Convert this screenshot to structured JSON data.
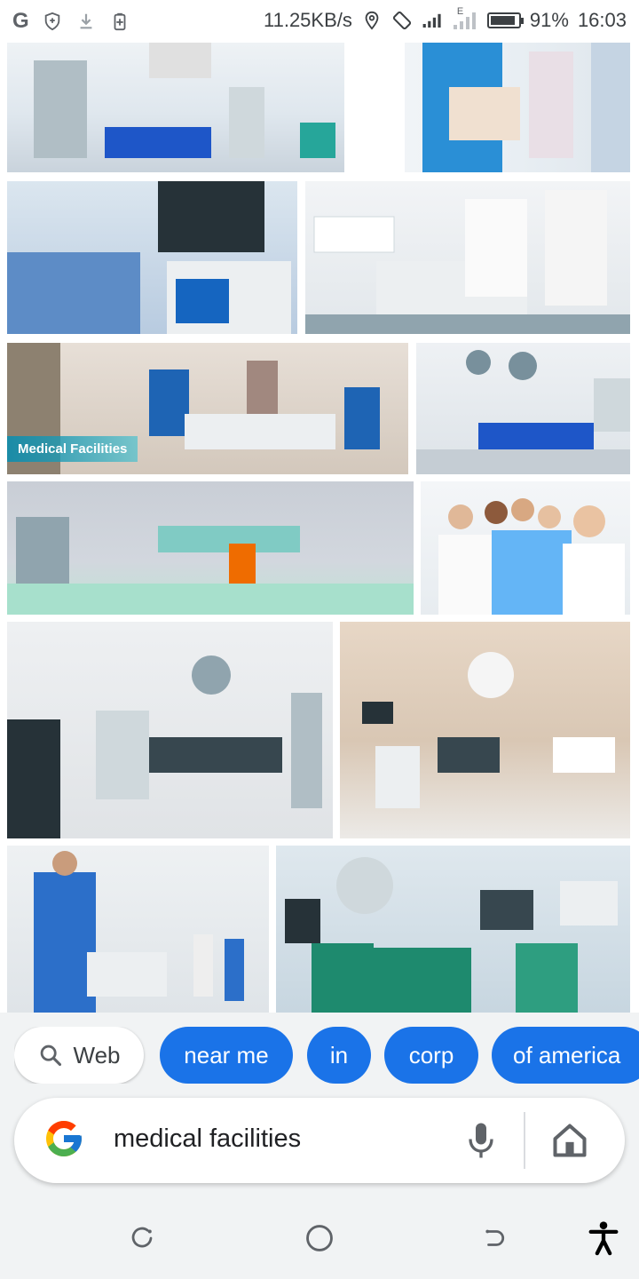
{
  "status_bar": {
    "app_letter": "G",
    "speed": "11.25KB/s",
    "network_type": "E",
    "battery": "91%",
    "battery_level": 0.91,
    "time": "16:03"
  },
  "results": {
    "caption_medical_facilities": "Medical Facilities"
  },
  "chips": [
    {
      "label": "Web",
      "icon": "search-icon"
    },
    {
      "label": "near me"
    },
    {
      "label": "in"
    },
    {
      "label": "corp"
    },
    {
      "label": "of america"
    }
  ],
  "search": {
    "query": "medical facilities",
    "logo": "google-g-logo",
    "mic_icon": "mic-icon",
    "home_icon": "home-icon"
  },
  "nav": {
    "icons": [
      "recents-icon",
      "home-circle-icon",
      "back-icon",
      "accessibility-icon"
    ]
  },
  "colors": {
    "accent": "#1a73e8",
    "panel_bg": "#f1f3f4"
  }
}
